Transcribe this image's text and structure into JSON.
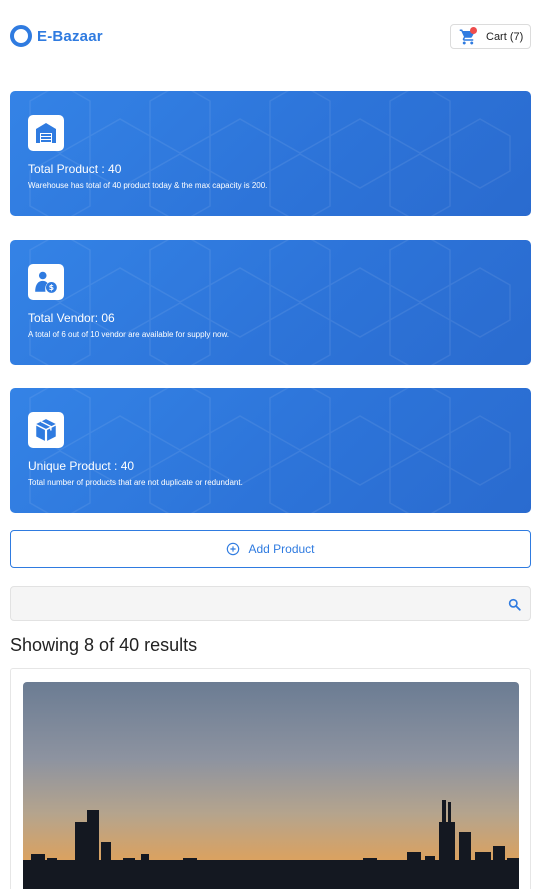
{
  "brand": {
    "name": "E-Bazaar",
    "logo_icon": "ring-logo-icon",
    "color": "#2f7be0"
  },
  "cart": {
    "label": "Cart (7)",
    "icon": "cart-icon",
    "badge_color": "#ee4d4d"
  },
  "stats": [
    {
      "icon": "warehouse-icon",
      "title": "Total Product : 40",
      "description": "Warehouse has total of 40 product today & the max capacity is 200."
    },
    {
      "icon": "vendor-icon",
      "title": "Total Vendor: 06",
      "description": "A total of 6 out of 10 vendor are available for supply now."
    },
    {
      "icon": "box-icon",
      "title": "Unique Product : 40",
      "description": "Total number of products that are not duplicate or redundant."
    }
  ],
  "add_product": {
    "label": "Add Product",
    "icon": "plus-circle-icon"
  },
  "search": {
    "placeholder": "",
    "icon": "search-icon"
  },
  "results_text": "Showing 8 of 40 results",
  "products": [
    {
      "image": "city-skyline-sunset"
    }
  ],
  "colors": {
    "card_blue": "#2f7be0",
    "accent": "#2f7be0"
  }
}
